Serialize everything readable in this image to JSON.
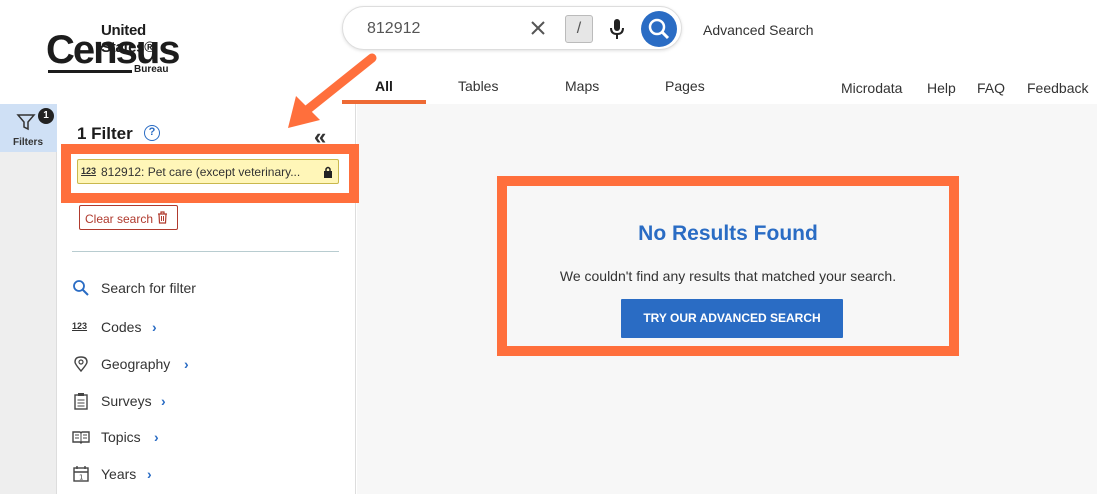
{
  "logo": {
    "line1": "United States®",
    "line2": "Census",
    "line3": "Bureau"
  },
  "search": {
    "value": "812912",
    "slash_key": "/",
    "advanced_label": "Advanced Search"
  },
  "tabs": [
    {
      "label": "All",
      "active": true
    },
    {
      "label": "Tables",
      "active": false
    },
    {
      "label": "Maps",
      "active": false
    },
    {
      "label": "Pages",
      "active": false
    }
  ],
  "top_links": [
    "Microdata",
    "Help",
    "FAQ",
    "Feedback"
  ],
  "rail": {
    "filters_label": "Filters",
    "badge": "1"
  },
  "filter_panel": {
    "title": "1 Filter",
    "help_glyph": "?",
    "collapse_glyph": "«",
    "chip_icon": "123",
    "chip_text": "812912: Pet care (except veterinary...",
    "clear_label": "Clear search",
    "items": [
      {
        "label": "Search for filter",
        "icon": "search-icon"
      },
      {
        "label": "Codes",
        "icon": "codes-icon"
      },
      {
        "label": "Geography",
        "icon": "location-pin-icon"
      },
      {
        "label": "Surveys",
        "icon": "clipboard-icon"
      },
      {
        "label": "Topics",
        "icon": "book-icon"
      },
      {
        "label": "Years",
        "icon": "calendar-icon"
      }
    ]
  },
  "results": {
    "heading": "No Results Found",
    "message": "We couldn't find any results that matched your search.",
    "button_label": "TRY OUR ADVANCED SEARCH"
  },
  "colors": {
    "accent_blue": "#2a6cc4",
    "annotation_orange": "#ff6f3c",
    "tab_underline": "#ee6a34",
    "chip_bg": "#fff6b8"
  }
}
